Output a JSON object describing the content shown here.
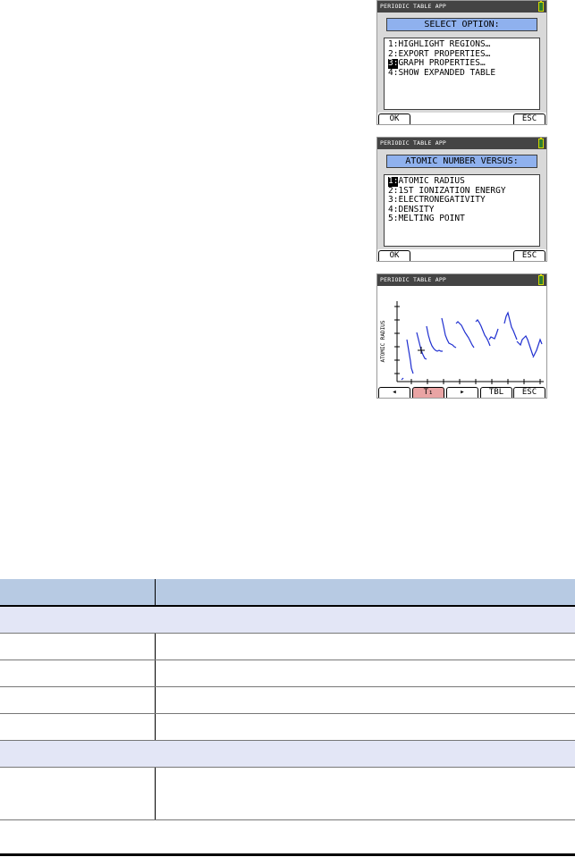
{
  "screen1": {
    "status_title": "PERIODIC TABLE APP",
    "title": "SELECT OPTION:",
    "items": [
      {
        "num": "1:",
        "label": "HIGHLIGHT REGIONS…"
      },
      {
        "num": "2:",
        "label": "EXPORT PROPERTIES…"
      },
      {
        "num": "3:",
        "label": "GRAPH PROPERTIES…",
        "selected": true
      },
      {
        "num": "4:",
        "label": "SHOW EXPANDED TABLE"
      }
    ],
    "softkeys": {
      "ok": "OK",
      "esc": "ESC"
    }
  },
  "screen2": {
    "status_title": "PERIODIC TABLE APP",
    "title": "ATOMIC NUMBER VERSUS:",
    "items": [
      {
        "num": "1:",
        "label": "ATOMIC RADIUS",
        "selected": true
      },
      {
        "num": "2:",
        "label": "1ST IONIZATION ENERGY"
      },
      {
        "num": "3:",
        "label": "ELECTRONEGATIVITY"
      },
      {
        "num": "4:",
        "label": "DENSITY"
      },
      {
        "num": "5:",
        "label": "MELTING POINT"
      }
    ],
    "softkeys": {
      "ok": "OK",
      "esc": "ESC"
    }
  },
  "screen3": {
    "status_title": "PERIODIC TABLE APP",
    "y_axis_label": "ATOMIC RADIUS",
    "softkeys": {
      "left": "◂",
      "trace": "T₁",
      "right": "▸",
      "tbl": "TBL",
      "esc": "ESC"
    }
  },
  "colors": {
    "status_bar": "#444444",
    "title_bar": "#8fb1ee",
    "calc_bg": "#d9d9d9",
    "graph_line": "#1f2fd0",
    "active_softkey": "#e9a4a4",
    "table_header": "#b7cae3",
    "table_section": "#e3e6f6"
  },
  "table": {
    "header": [
      "",
      ""
    ],
    "rows": [
      {
        "kind": "section",
        "text": ""
      },
      {
        "kind": "data",
        "c1": "",
        "c2": ""
      },
      {
        "kind": "data",
        "c1": "",
        "c2": ""
      },
      {
        "kind": "data",
        "c1": "",
        "c2": ""
      },
      {
        "kind": "data",
        "c1": "",
        "c2": ""
      },
      {
        "kind": "section",
        "text": ""
      },
      {
        "kind": "data",
        "c1": "",
        "c2": "",
        "tall": true
      }
    ]
  }
}
